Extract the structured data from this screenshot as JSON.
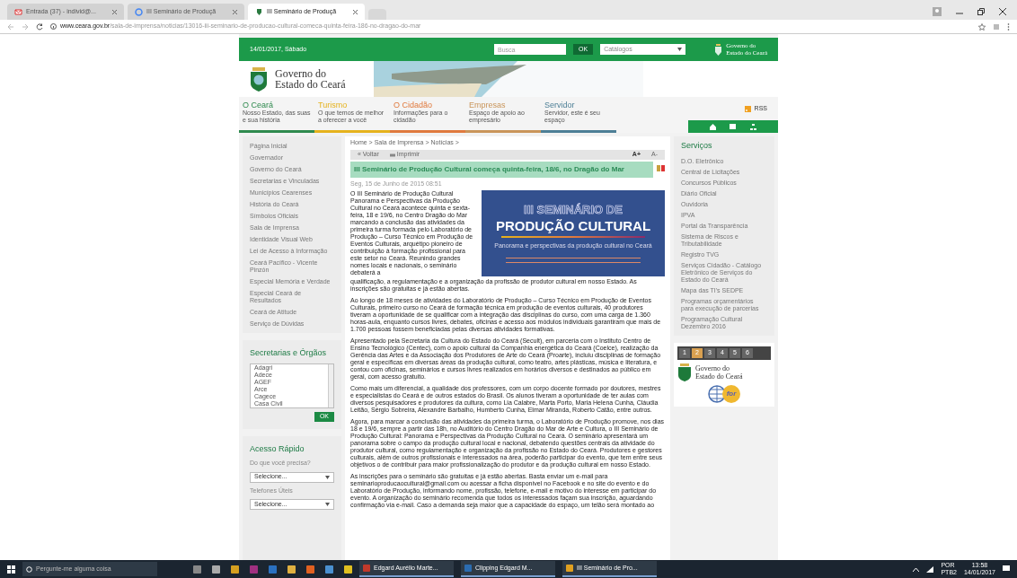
{
  "browser": {
    "tabs": [
      {
        "title": "Entrada (37) - individ@...",
        "kind": "mail",
        "selected": false
      },
      {
        "title": "III Seminário de Produçã",
        "kind": "google",
        "selected": false
      },
      {
        "title": "III Seminário de Produçã",
        "kind": "site",
        "selected": true
      }
    ],
    "url_host": "www.ceara.gov.br",
    "url_path": "/sala-de-imprensa/noticias/13016-iii-seminario-de-producao-cultural-comeca-quinta-feira-186-no-dragao-do-mar"
  },
  "site": {
    "top_bar": {
      "date": "14/01/2017, Sábado",
      "search_placeholder": "Busca",
      "ok": "OK",
      "dropdown": "Catálogos",
      "logo_line1": "Governo do",
      "logo_line2": "Estado do Ceará"
    },
    "header": {
      "logo_line1": "Governo do",
      "logo_line2": "Estado do Ceará"
    },
    "nav": [
      {
        "title": "O Ceará",
        "subtitle": "Nosso Estado, das suas e sua história",
        "color": "#2f8a4e"
      },
      {
        "title": "Turismo",
        "subtitle": "O que temos de melhor a oferecer a você",
        "color": "#e5b21c"
      },
      {
        "title": "O Cidadão",
        "subtitle": "Informações para o cidadão",
        "color": "#e07a3e"
      },
      {
        "title": "Empresas",
        "subtitle": "Espaço de apoio ao empresário",
        "color": "#c9955a"
      },
      {
        "title": "Servidor",
        "subtitle": "Servidor, este é seu espaço",
        "color": "#4d7f96"
      }
    ],
    "rss": "RSS",
    "left_menu": [
      "Página Inicial",
      "Governador",
      "Governo do Ceará",
      "Secretarias e Vinculadas",
      "Municípios Cearenses",
      "História do Ceará",
      "Símbolos Oficiais",
      "Sala de Imprensa",
      "Identidade Visual Web",
      "Lei de Acesso à Informação",
      "Ceará Pacífico - Vicente Pinzón",
      "Especial Memória e Verdade",
      "Especial Ceará de Resultados",
      "Ceará de Atitude",
      "Serviço de Dúvidas"
    ],
    "secretarias": {
      "title": "Secretarias e Órgãos",
      "options": [
        "Adagri",
        "Adece",
        "AGEF",
        "Arce",
        "Cagece",
        "Casa Civil"
      ],
      "ok": "OK"
    },
    "acesso": {
      "title": "Acesso Rápido",
      "label_1": "Do que você precisa?",
      "select_1": "Selecione...",
      "label_2": "Telefones Úteis",
      "select_2": "Selecione..."
    },
    "article": {
      "breadcrumb": "Home > Sala de Imprensa > Notícias >",
      "back": "« Voltar",
      "print": "Imprimir",
      "font_up": "A+",
      "font_down": "A-",
      "title": "III Seminário de Produção Cultural começa quinta-feira, 18/6, no Dragão do Mar",
      "date": "Seg, 15 de Junho de 2015 08:51",
      "lead": "O III Seminário de Produção Cultural Panorama e Perspectivas da Produção Cultural no Ceará acontece quinta e sexta-feira, 18 e 19/6, no Centro Dragão do Mar marcando a conclusão das atividades da primeira turma formada pelo Laboratório de Produção – Curso Técnico em Produção de Eventos Culturais, arquétipo pioneiro de contribuição à formação profissional para este setor no Ceará. Reunindo grandes nomes locais e nacionais, o seminário debaterá a",
      "lead_end": "qualificação, a regulamentação e a organização da profissão de produtor cultural em nosso Estado. As inscrições são gratuitas e já estão abertas.",
      "banner": {
        "line_1": "III SEMINÁRIO DE",
        "line_2": "PRODUÇÃO CULTURAL",
        "line_3": "Panorama e perspectivas da produção cultural no Ceará"
      },
      "paragraphs": [
        "Ao longo de 18 meses de atividades do Laboratório de Produção – Curso Técnico em Produção de Eventos Culturais, primeiro curso no Ceará de formação técnica em produção de eventos culturais, 40 produtores tiveram a oportunidade de se qualificar com a integração das disciplinas do curso, com uma carga de 1.360 horas-aula, enquanto cursos livres, debates, oficinas e acesso aos módulos individuais garantiram que mais de 1.700 pessoas fossem beneficiadas pelas diversas atividades formativas.",
        "Apresentado pela Secretaria da Cultura do Estado do Ceará (Secult), em parceria com o Instituto Centro de Ensino Tecnológico (Centec), com o apoio cultural da Companhia energética do Ceará (Coelce), realização da Gerência das Artes e da Associação dos Produtores de Arte do Ceará (Proarte), incluiu disciplinas de formação geral e específicas em diversas áreas da produção cultural, como teatro, artes plásticas, música e literatura, e contou com oficinas, seminários e cursos livres realizados em horários diversos e destinados ao público em geral, com acesso gratuito.",
        "Como mais um diferencial, a qualidade dos professores, com um corpo docente formado por doutores, mestres e especialistas do Ceará e de outros estados do Brasil. Os alunos tiveram a oportunidade de ter aulas com diversos pesquisadores e produtores da cultura, como Lia Calabre, Marta Porto, Maria Helena Cunha, Cláudia Leitão, Sérgio Sobreira, Alexandre Barbalho, Humberto Cunha, Elmar Miranda, Roberto Catão, entre outros.",
        "Agora, para marcar a conclusão das atividades da primeira turma, o Laboratório de Produção promove, nos dias 18 e 19/6, sempre a partir das 18h, no Auditório do Centro Dragão do Mar de Arte e Cultura, o III Seminário de Produção Cultural: Panorama e Perspectivas da Produção Cultural no Ceará. O seminário apresentará um panorama sobre o campo da produção cultural local e nacional, debatendo questões centrais da atividade do produtor cultural, como regulamentação e organização da profissão no Estado do Ceará. Produtores e gestores culturais, além de outros profissionais e interessados na área, poderão participar do evento, que tem entre seus objetivos o de contribuir para maior profissionalização do produtor e da produção cultural em nosso Estado.",
        "As inscrições para o seminário são gratuitas e já estão abertas. Basta enviar um e-mail para seminarioproducaocultural@gmail.com ou acessar a ficha disponível no Facebook e no site do evento e do Laboratório de Produção, informando nome, profissão, telefone, e-mail e motivo do interesse em participar do evento. A organização do seminário recomenda que todos os interessados façam sua inscrição, aguardando confirmação via e-mail. Caso a demanda seja maior que a capacidade do espaço, um telão será montado ao"
      ]
    },
    "services": {
      "title": "Serviços",
      "items": [
        "D.O. Eletrônico",
        "Central de Licitações",
        "Concursos Públicos",
        "Diário Oficial",
        "Ouvidoria",
        "IPVA",
        "Portal da Transparência",
        "Sistema de Riscos e Tributabilidade",
        "Registro TVG",
        "Serviços Cidadão - Catálogo Eletrônico de Serviços do Estado do Ceará",
        "Mapa das TI's SEDPE",
        "Programas orçamentários para execução de parcerias",
        "Programação Cultural Dezembro 2016"
      ]
    },
    "carousel": {
      "pages": [
        {
          "label": "1",
          "selected": false
        },
        {
          "label": "2",
          "selected": true
        },
        {
          "label": "3",
          "selected": false
        },
        {
          "label": "4",
          "selected": false
        },
        {
          "label": "5",
          "selected": false
        },
        {
          "label": "6",
          "selected": false
        }
      ],
      "logo_line1": "Governo do",
      "logo_line2": "Estado do Ceará",
      "seal_text": "for"
    }
  },
  "taskbar": {
    "search_placeholder": "Pergunte-me alguma coisa",
    "apps": [
      {
        "label": "Edgard Aurélio Marte...",
        "color": "#c0392b"
      },
      {
        "label": "Clipping Edgard M...",
        "color": "#2b6cb0"
      },
      {
        "label": "III Seminário de Pro...",
        "color": "#e0a020"
      }
    ],
    "lang_1": "POR",
    "lang_2": "PTB2",
    "time": "13:58",
    "date": "14/01/2017"
  }
}
